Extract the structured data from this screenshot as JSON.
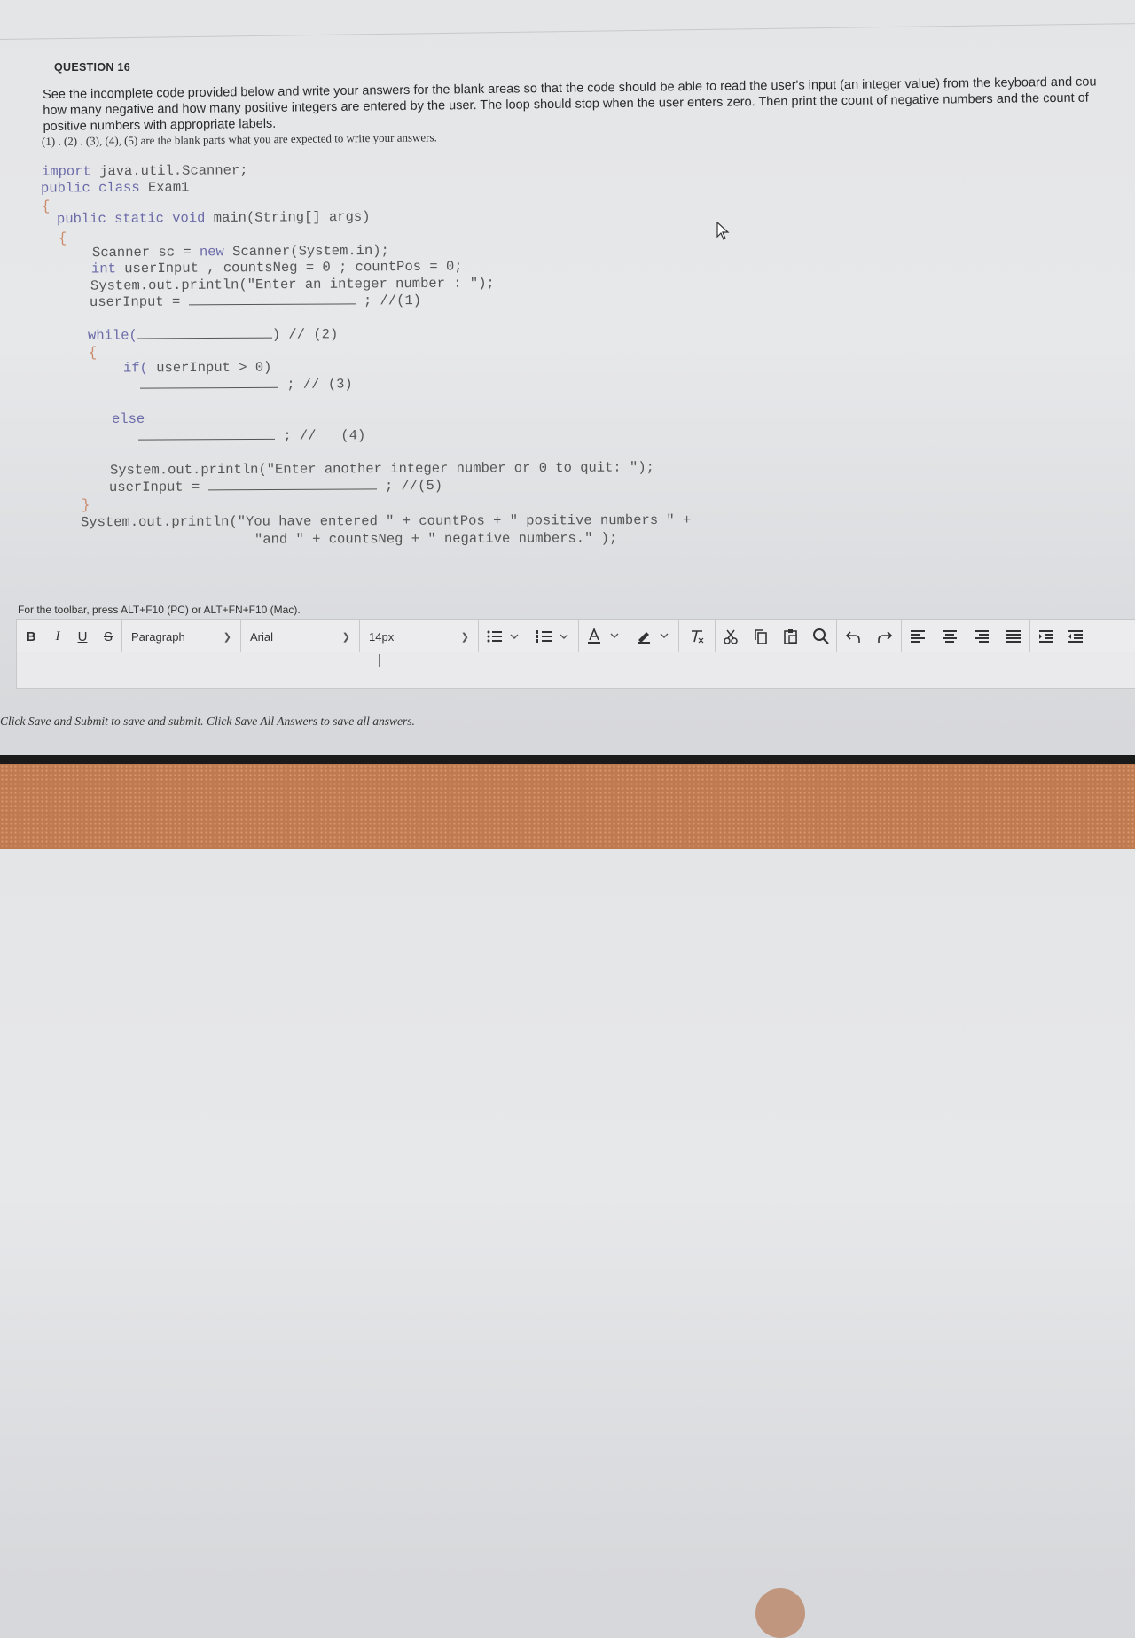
{
  "question": {
    "title": "QUESTION 16",
    "intro_lines": [
      "See the incomplete code provided below and write your answers for the blank areas so that the code should be able to read the user's input (an integer value) from the keyboard and cou",
      "how many negative and how many positive integers are entered by the user. The loop should stop when the user enters zero. Then print the count of negative numbers and the count of",
      "positive numbers with appropriate labels."
    ],
    "note": "(1) . (2) . (3), (4), (5) are the blank parts what you are expected to write your answers."
  },
  "code": {
    "import_kw": "import",
    "import_rest": " java.util.Scanner;",
    "class_kw": "public class",
    "class_name": " Exam1",
    "open_brace": "{",
    "main_kw": "public static void",
    "main_rest": " main(String[] args)",
    "scanner_line_a": "Scanner sc = ",
    "new_kw": "new",
    "scanner_line_b": " Scanner(System.in);",
    "int_kw": "int",
    "int_rest": " userInput , countsNeg = 0 ; countPos = 0;",
    "print1": "System.out.println(\"Enter an integer number : \");",
    "input1_left": "userInput = ",
    "input1_right": " ; //(1)",
    "while_kw": "while(",
    "while_right": ") // (2)",
    "if_kw": "if(",
    "if_rest": " userInput > 0)",
    "blank3_right": " ; // (3)",
    "else_kw": "else",
    "blank4_right": " ; //   (4)",
    "print2": "System.out.println(\"Enter another integer number or 0 to quit: \");",
    "input2_left": "userInput = ",
    "input2_right": " ; //(5)",
    "close_brace": "}",
    "print3_a": "System.out.println(\"You have entered \" + countPos + \" positive numbers \" +",
    "print3_b": "\"and \" + countsNeg + \" negative numbers.\" );"
  },
  "editor": {
    "toolbar_hint": "For the toolbar, press ALT+F10 (PC) or ALT+FN+F10 (Mac).",
    "bold": "B",
    "italic": "I",
    "underline": "U",
    "strike": "S",
    "block_format": "Paragraph",
    "font_family": "Arial",
    "font_size": "14px"
  },
  "footer_note": "Click Save and Submit to save and submit. Click Save All Answers to save all answers."
}
